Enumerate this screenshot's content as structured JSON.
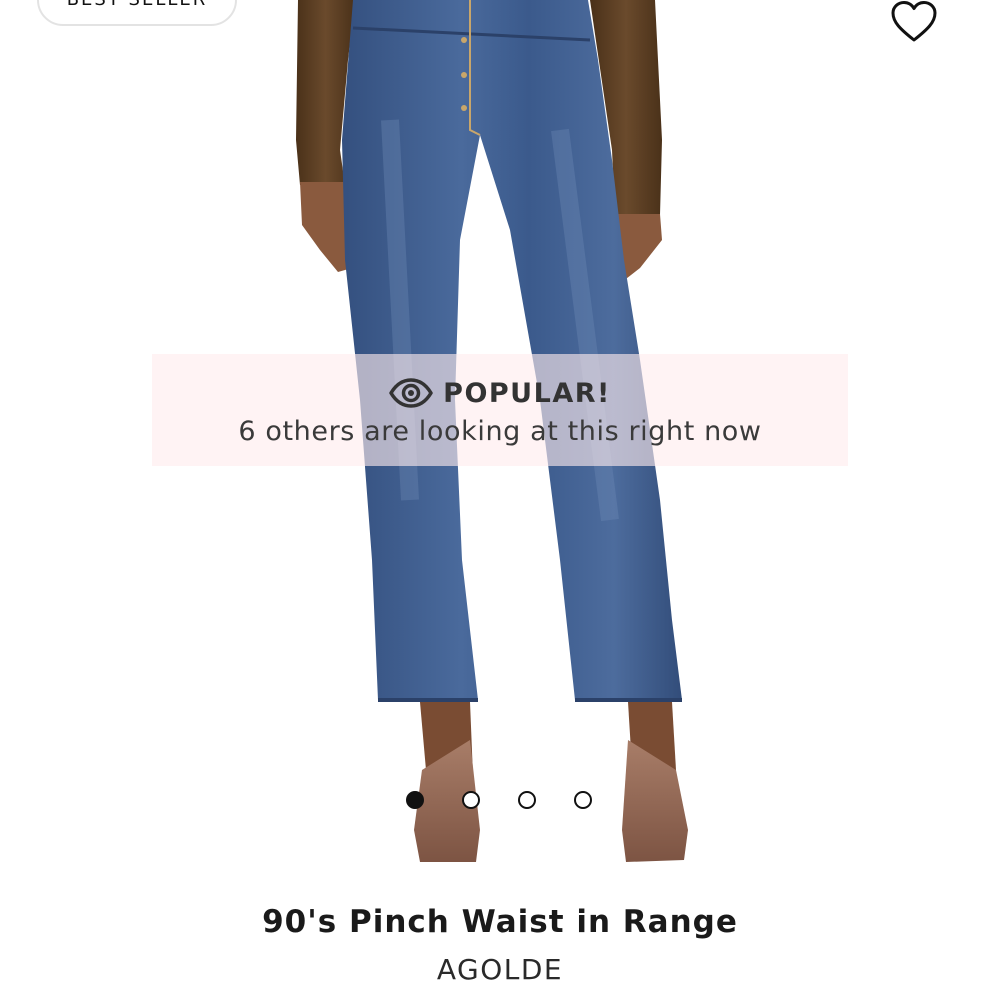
{
  "badge": {
    "label": "BEST SELLER"
  },
  "wishlist": {
    "icon": "heart-outline-icon"
  },
  "popular": {
    "icon": "eye-icon",
    "title": "POPULAR!",
    "subtitle": "6 others are looking at this right now"
  },
  "carousel": {
    "total": 4,
    "active_index": 0
  },
  "product": {
    "title": "90's Pinch Waist in Range",
    "brand": "AGOLDE"
  },
  "colors": {
    "denim": "#3f5d8f",
    "sweater": "#5b3e24",
    "skin": "#8a5a3e",
    "popular_bg": "#fdeef0"
  }
}
